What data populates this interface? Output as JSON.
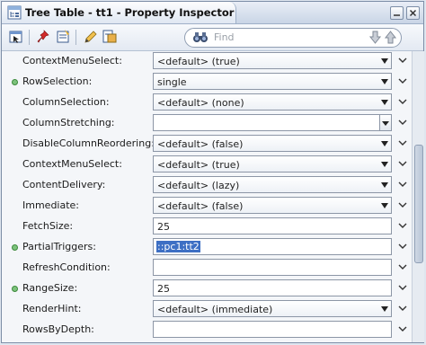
{
  "window": {
    "title": "Tree Table - tt1 - Property Inspector"
  },
  "toolbar": {
    "buttons": [
      "select-mode-icon",
      "pin-icon",
      "edit-properties-icon",
      "pencil-icon",
      "bind-icon"
    ],
    "search_placeholder": "Find"
  },
  "properties": [
    {
      "label": "ContextMenuSelect:",
      "value": "<default> (true)",
      "kind": "select",
      "required": false
    },
    {
      "label": "RowSelection:",
      "value": "single",
      "kind": "select",
      "required": true
    },
    {
      "label": "ColumnSelection:",
      "value": "<default> (none)",
      "kind": "select",
      "required": false
    },
    {
      "label": "ColumnStretching:",
      "value": "",
      "kind": "combo",
      "required": false
    },
    {
      "label": "DisableColumnReordering:",
      "value": "<default> (false)",
      "kind": "select",
      "required": false
    },
    {
      "label": "ContextMenuSelect:",
      "value": "<default> (true)",
      "kind": "select",
      "required": false
    },
    {
      "label": "ContentDelivery:",
      "value": "<default> (lazy)",
      "kind": "select",
      "required": false
    },
    {
      "label": "Immediate:",
      "value": "<default> (false)",
      "kind": "select",
      "required": false
    },
    {
      "label": "FetchSize:",
      "value": "25",
      "kind": "text",
      "required": false
    },
    {
      "label": "PartialTriggers:",
      "value": "::pc1:tt2",
      "kind": "text-selected",
      "required": true
    },
    {
      "label": "RefreshCondition:",
      "value": "",
      "kind": "text",
      "required": false
    },
    {
      "label": "RangeSize:",
      "value": "25",
      "kind": "text",
      "required": true
    },
    {
      "label": "RenderHint:",
      "value": "<default> (immediate)",
      "kind": "select",
      "required": false
    },
    {
      "label": "RowsByDepth:",
      "value": "",
      "kind": "text",
      "required": false
    }
  ],
  "colors": {
    "selection": "#3d6fc4",
    "required_dot": "#7cc27c"
  }
}
